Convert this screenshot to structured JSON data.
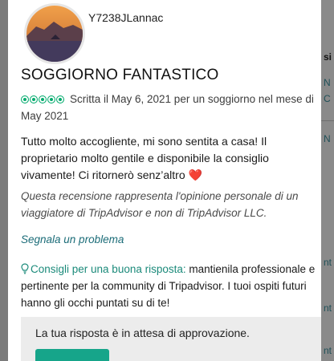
{
  "reviewer": {
    "username": "Y7238JLannac"
  },
  "review": {
    "title": "SOGGIORNO FANTASTICO",
    "rating": 5,
    "meta_text": "Scritta il May 6, 2021 per un soggiorno nel mese di May 2021",
    "body": "Tutto molto accogliente, mi sono sentita a casa! Il proprietario molto gentile e disponibile la consiglio vivamente! Ci ritornerò senz’altro",
    "disclaimer": "Questa recensione rappresenta l'opinione personale di un viaggiatore di TripAdvisor e non di TripAdvisor LLC.",
    "report_link": "Segnala un problema"
  },
  "tips": {
    "label": "Consigli per una buona risposta:",
    "text": " mantienila professionale e pertinente per la community di Tripadvisor. I tuoi ospiti futuri hanno gli occhi puntati su di te!"
  },
  "notice": {
    "text": "La tua risposta è in attesa di approvazione."
  },
  "colors": {
    "rating_bubble": "#00aa6c",
    "link": "#1b6c78",
    "tip_label": "#1b8a7a",
    "heart": "#e0242a",
    "button": "#16a58a"
  }
}
